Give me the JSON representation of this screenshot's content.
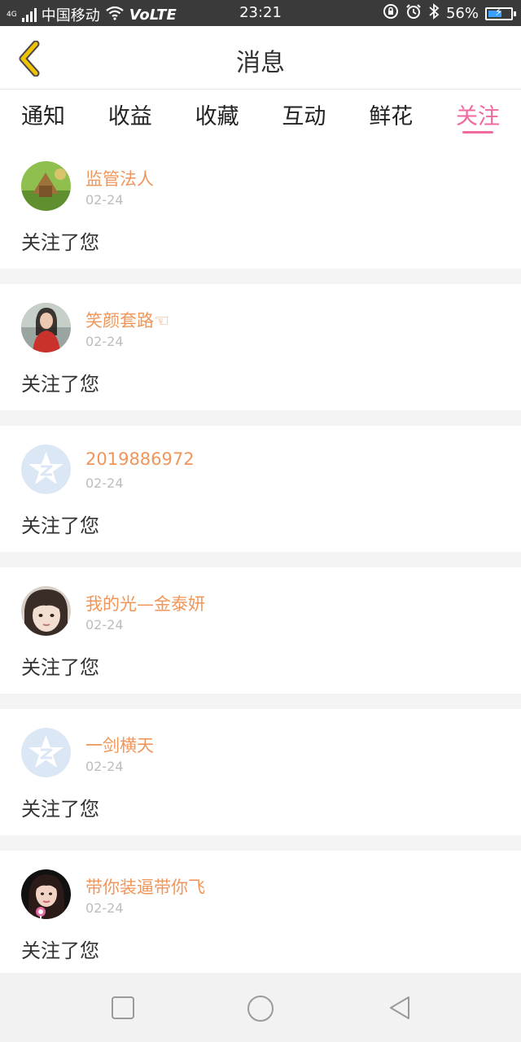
{
  "status_bar": {
    "network_prefix": "4G",
    "carrier": "中国移动",
    "volte": "VoLTE",
    "time": "23:21",
    "battery_percent": "56%"
  },
  "header": {
    "title": "消息"
  },
  "tabs": [
    {
      "label": "通知",
      "active": false
    },
    {
      "label": "收益",
      "active": false
    },
    {
      "label": "收藏",
      "active": false
    },
    {
      "label": "互动",
      "active": false
    },
    {
      "label": "鲜花",
      "active": false
    },
    {
      "label": "关注",
      "active": true
    }
  ],
  "messages": [
    {
      "username": "监管法人",
      "date": "02-24",
      "text": "关注了您",
      "avatar": "landscape-photo"
    },
    {
      "username": "笑颜套路☜",
      "date": "02-24",
      "text": "关注了您",
      "avatar": "portrait-photo-red"
    },
    {
      "username": "2019886972",
      "date": "02-24",
      "text": "关注了您",
      "avatar": "default-star-avatar"
    },
    {
      "username": "我的光—金泰妍",
      "date": "02-24",
      "text": "关注了您",
      "avatar": "portrait-photo-face"
    },
    {
      "username": "一剑横天",
      "date": "02-24",
      "text": "关注了您",
      "avatar": "default-star-avatar"
    },
    {
      "username": "带你装逼带你飞",
      "date": "02-24",
      "text": "关注了您",
      "avatar": "portrait-photo-dark"
    }
  ],
  "colors": {
    "accent_pink": "#f06aa0",
    "username_orange": "#f0965a",
    "back_arrow_yellow": "#f2c200",
    "date_gray": "#bdbdbd"
  },
  "nav_bar": {
    "icons": [
      "recent-apps-icon",
      "home-icon",
      "back-icon"
    ]
  }
}
